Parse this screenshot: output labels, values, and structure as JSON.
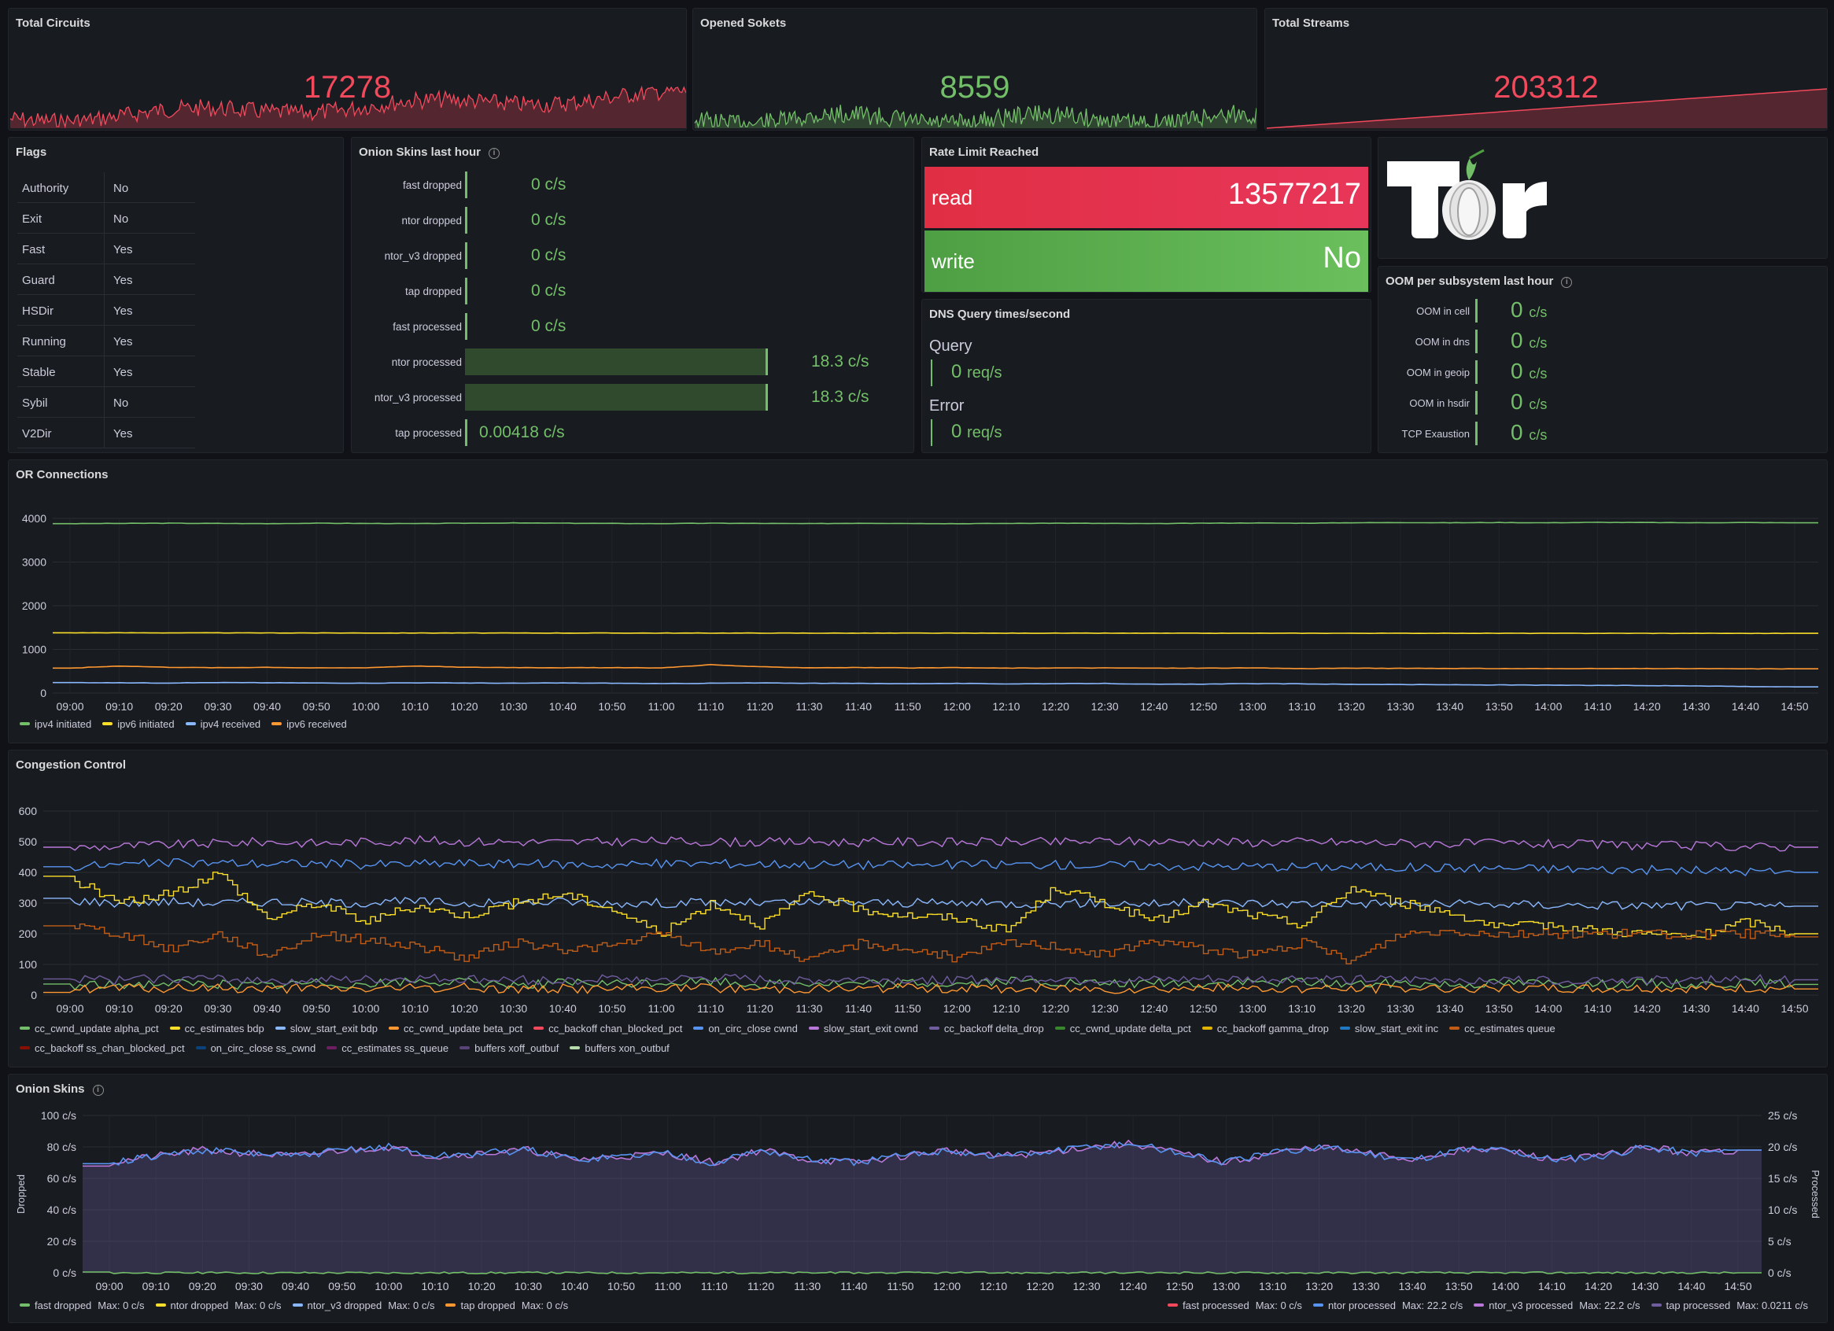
{
  "stats": {
    "total_circuits": {
      "title": "Total Circuits",
      "value": "17278",
      "color": "#f2495c"
    },
    "opened_sockets": {
      "title": "Opened Sokets",
      "value": "8559",
      "color": "#73bf69"
    },
    "total_streams": {
      "title": "Total Streams",
      "value": "203312",
      "color": "#f2495c"
    }
  },
  "flags": {
    "title": "Flags",
    "rows": [
      {
        "name": "Authority",
        "value": "No"
      },
      {
        "name": "Exit",
        "value": "No"
      },
      {
        "name": "Fast",
        "value": "Yes"
      },
      {
        "name": "Guard",
        "value": "Yes"
      },
      {
        "name": "HSDir",
        "value": "Yes"
      },
      {
        "name": "Running",
        "value": "Yes"
      },
      {
        "name": "Stable",
        "value": "Yes"
      },
      {
        "name": "Sybil",
        "value": "No"
      },
      {
        "name": "V2Dir",
        "value": "Yes"
      }
    ]
  },
  "onion_skins_hour": {
    "title": "Onion Skins last hour",
    "rows": [
      {
        "label": "fast dropped",
        "value": "0 c/s",
        "fill": 0
      },
      {
        "label": "ntor dropped",
        "value": "0 c/s",
        "fill": 0
      },
      {
        "label": "ntor_v3 dropped",
        "value": "0 c/s",
        "fill": 0
      },
      {
        "label": "tap dropped",
        "value": "0 c/s",
        "fill": 0
      },
      {
        "label": "fast processed",
        "value": "0 c/s",
        "fill": 0
      },
      {
        "label": "ntor processed",
        "value": "18.3 c/s",
        "fill": 0.82
      },
      {
        "label": "ntor_v3 processed",
        "value": "18.3 c/s",
        "fill": 0.82
      },
      {
        "label": "tap processed",
        "value": "0.00418 c/s",
        "fill": 0
      }
    ]
  },
  "rate_limit": {
    "title": "Rate Limit Reached",
    "read": {
      "label": "read",
      "value": "13577217",
      "color": "#e02f44"
    },
    "write": {
      "label": "write",
      "value": "No",
      "color": "#56a64b"
    }
  },
  "logo": {
    "text": "Tor"
  },
  "dns": {
    "title": "DNS Query times/second",
    "query": {
      "label": "Query",
      "value": "0",
      "unit": "req/s"
    },
    "error": {
      "label": "Error",
      "value": "0",
      "unit": "req/s"
    }
  },
  "oom": {
    "title": "OOM per subsystem last hour",
    "rows": [
      {
        "label": "OOM in cell",
        "value": "0",
        "unit": "c/s"
      },
      {
        "label": "OOM in dns",
        "value": "0",
        "unit": "c/s"
      },
      {
        "label": "OOM in geoip",
        "value": "0",
        "unit": "c/s"
      },
      {
        "label": "OOM in hsdir",
        "value": "0",
        "unit": "c/s"
      },
      {
        "label": "TCP Exaustion",
        "value": "0",
        "unit": "c/s"
      }
    ]
  },
  "time_ticks": [
    "09:00",
    "09:10",
    "09:20",
    "09:30",
    "09:40",
    "09:50",
    "10:00",
    "10:10",
    "10:20",
    "10:30",
    "10:40",
    "10:50",
    "11:00",
    "11:10",
    "11:20",
    "11:30",
    "11:40",
    "11:50",
    "12:00",
    "12:10",
    "12:20",
    "12:30",
    "12:40",
    "12:50",
    "13:00",
    "13:10",
    "13:20",
    "13:30",
    "13:40",
    "13:50",
    "14:00",
    "14:10",
    "14:20",
    "14:30",
    "14:40",
    "14:50"
  ],
  "or_connections": {
    "title": "OR Connections",
    "legend": [
      {
        "name": "ipv4 initiated",
        "color": "#73bf69"
      },
      {
        "name": "ipv6 initiated",
        "color": "#fade2a"
      },
      {
        "name": "ipv4 received",
        "color": "#8ab8ff"
      },
      {
        "name": "ipv6 received",
        "color": "#ff9830"
      }
    ]
  },
  "congestion": {
    "title": "Congestion Control",
    "legend_row1": [
      {
        "name": "cc_cwnd_update alpha_pct",
        "color": "#73bf69"
      },
      {
        "name": "cc_estimates bdp",
        "color": "#fade2a"
      },
      {
        "name": "slow_start_exit bdp",
        "color": "#8ab8ff"
      },
      {
        "name": "cc_cwnd_update beta_pct",
        "color": "#ff9830"
      },
      {
        "name": "cc_backoff chan_blocked_pct",
        "color": "#f2495c"
      },
      {
        "name": "on_circ_close cwnd",
        "color": "#5794f2"
      },
      {
        "name": "slow_start_exit cwnd",
        "color": "#b877d9"
      },
      {
        "name": "cc_backoff delta_drop",
        "color": "#705da0"
      },
      {
        "name": "cc_cwnd_update delta_pct",
        "color": "#37872d"
      },
      {
        "name": "cc_backoff gamma_drop",
        "color": "#e0b400"
      },
      {
        "name": "slow_start_exit inc",
        "color": "#1f78c1"
      },
      {
        "name": "cc_estimates queue",
        "color": "#c15c17"
      }
    ],
    "legend_row2": [
      {
        "name": "cc_backoff ss_chan_blocked_pct",
        "color": "#890f02"
      },
      {
        "name": "on_circ_close ss_cwnd",
        "color": "#0a437c"
      },
      {
        "name": "cc_estimates ss_queue",
        "color": "#6d1f62"
      },
      {
        "name": "buffers xoff_outbuf",
        "color": "#584477"
      },
      {
        "name": "buffers xon_outbuf",
        "color": "#b7dbab"
      }
    ]
  },
  "onion_skins": {
    "title": "Onion Skins",
    "y_left_label": "Dropped",
    "y_right_label": "Processed",
    "legend_left": [
      {
        "name": "fast dropped",
        "max": "Max: 0 c/s",
        "color": "#73bf69"
      },
      {
        "name": "ntor dropped",
        "max": "Max: 0 c/s",
        "color": "#fade2a"
      },
      {
        "name": "ntor_v3 dropped",
        "max": "Max: 0 c/s",
        "color": "#8ab8ff"
      },
      {
        "name": "tap dropped",
        "max": "Max: 0 c/s",
        "color": "#ff9830"
      }
    ],
    "legend_right": [
      {
        "name": "fast processed",
        "max": "Max: 0 c/s",
        "color": "#f2495c"
      },
      {
        "name": "ntor processed",
        "max": "Max: 22.2 c/s",
        "color": "#5794f2"
      },
      {
        "name": "ntor_v3 processed",
        "max": "Max: 22.2 c/s",
        "color": "#b877d9"
      },
      {
        "name": "tap processed",
        "max": "Max: 0.0211 c/s",
        "color": "#705da0"
      }
    ]
  },
  "chart_data": [
    {
      "type": "line",
      "title": "OR Connections",
      "x": [
        "09:00",
        "09:10",
        "09:20",
        "09:30",
        "09:40",
        "09:50",
        "10:00",
        "10:10",
        "10:20",
        "10:30",
        "10:40",
        "10:50",
        "11:00",
        "11:10",
        "11:20",
        "11:30",
        "11:40",
        "11:50",
        "12:00",
        "12:10",
        "12:20",
        "12:30",
        "12:40",
        "12:50",
        "13:00",
        "13:10",
        "13:20",
        "13:30",
        "13:40",
        "13:50",
        "14:00",
        "14:10",
        "14:20",
        "14:30",
        "14:40",
        "14:50"
      ],
      "ylim": [
        0,
        4000
      ],
      "yticks": [
        "0",
        "1000",
        "2000",
        "3000",
        "4000"
      ],
      "series": [
        {
          "name": "ipv4 initiated",
          "values": [
            3880,
            3885,
            3890,
            3885,
            3880,
            3890,
            3885,
            3880,
            3890,
            3895,
            3890,
            3885,
            3880,
            3890,
            3885,
            3880,
            3890,
            3885,
            3880,
            3885,
            3890,
            3885,
            3880,
            3890,
            3895,
            3890,
            3900,
            3905,
            3900,
            3905,
            3900,
            3910,
            3905,
            3900,
            3905,
            3900
          ]
        },
        {
          "name": "ipv6 initiated",
          "values": [
            1380,
            1380,
            1378,
            1378,
            1376,
            1376,
            1375,
            1375,
            1375,
            1374,
            1374,
            1374,
            1373,
            1373,
            1373,
            1372,
            1372,
            1372,
            1372,
            1371,
            1371,
            1371,
            1370,
            1370,
            1370,
            1370,
            1369,
            1369,
            1369,
            1369,
            1368,
            1368,
            1368,
            1368,
            1367,
            1367
          ]
        },
        {
          "name": "ipv4 received",
          "values": [
            240,
            235,
            230,
            240,
            235,
            230,
            225,
            235,
            230,
            225,
            230,
            225,
            215,
            225,
            230,
            225,
            220,
            215,
            220,
            210,
            215,
            220,
            200,
            205,
            215,
            210,
            200,
            195,
            190,
            185,
            180,
            175,
            170,
            165,
            150,
            140
          ]
        },
        {
          "name": "ipv6 received",
          "values": [
            570,
            620,
            590,
            580,
            590,
            575,
            580,
            620,
            590,
            585,
            580,
            580,
            575,
            650,
            600,
            580,
            585,
            575,
            580,
            570,
            575,
            575,
            570,
            570,
            575,
            560,
            570,
            565,
            565,
            560,
            560,
            560,
            560,
            560,
            555,
            555
          ]
        }
      ]
    },
    {
      "type": "line",
      "title": "Congestion Control",
      "x": [
        "09:00",
        "09:10",
        "09:20",
        "09:30",
        "09:40",
        "09:50",
        "10:00",
        "10:10",
        "10:20",
        "10:30",
        "10:40",
        "10:50",
        "11:00",
        "11:10",
        "11:20",
        "11:30",
        "11:40",
        "11:50",
        "12:00",
        "12:10",
        "12:20",
        "12:30",
        "12:40",
        "12:50",
        "13:00",
        "13:10",
        "13:20",
        "13:30",
        "13:40",
        "13:50",
        "14:00",
        "14:10",
        "14:20",
        "14:30",
        "14:40",
        "14:50"
      ],
      "ylim": [
        0,
        600
      ],
      "yticks": [
        "0",
        "100",
        "200",
        "300",
        "400",
        "500",
        "600"
      ],
      "series": [
        {
          "name": "slow_start_exit cwnd",
          "values": [
            480,
            485,
            490,
            495,
            500,
            495,
            500,
            505,
            500,
            500,
            498,
            500,
            502,
            500,
            498,
            500,
            498,
            500,
            498,
            500,
            498,
            502,
            500,
            500,
            498,
            500,
            498,
            496,
            494,
            494,
            492,
            490,
            488,
            486,
            484,
            482
          ]
        },
        {
          "name": "on_circ_close cwnd",
          "values": [
            420,
            425,
            430,
            432,
            428,
            430,
            425,
            428,
            430,
            428,
            426,
            425,
            428,
            430,
            428,
            426,
            425,
            424,
            425,
            426,
            425,
            423,
            422,
            420,
            420,
            418,
            418,
            416,
            415,
            414,
            412,
            410,
            408,
            406,
            404,
            400
          ]
        },
        {
          "name": "slow_start_exit bdp",
          "values": [
            310,
            300,
            305,
            300,
            305,
            300,
            302,
            305,
            300,
            300,
            305,
            300,
            300,
            302,
            300,
            300,
            302,
            300,
            300,
            298,
            300,
            300,
            298,
            300,
            300,
            298,
            300,
            298,
            296,
            296,
            294,
            294,
            292,
            292,
            290,
            290
          ]
        },
        {
          "name": "cc_estimates bdp",
          "values": [
            380,
            300,
            330,
            400,
            250,
            300,
            240,
            290,
            260,
            300,
            330,
            280,
            200,
            300,
            230,
            330,
            280,
            260,
            250,
            210,
            350,
            300,
            240,
            300,
            260,
            230,
            350,
            300,
            270,
            220,
            230,
            210,
            200,
            190,
            240,
            200
          ]
        },
        {
          "name": "cc_estimates queue",
          "values": [
            230,
            200,
            150,
            200,
            130,
            200,
            180,
            160,
            120,
            170,
            150,
            160,
            200,
            140,
            170,
            110,
            170,
            150,
            120,
            170,
            160,
            130,
            180,
            150,
            130,
            170,
            110,
            200,
            210,
            200,
            200,
            200,
            200,
            195,
            200,
            190
          ]
        },
        {
          "name": "cc_cwnd_update alpha_pct",
          "values": [
            30,
            35,
            40,
            35,
            30,
            40,
            35,
            45,
            40,
            35,
            40,
            35,
            40,
            45,
            35,
            40,
            35,
            40,
            35,
            45,
            40,
            35,
            40,
            35,
            40,
            45,
            35,
            40,
            35,
            40,
            40,
            35,
            40,
            35,
            40,
            35
          ]
        },
        {
          "name": "cc_cwnd_update beta_pct",
          "values": [
            20,
            22,
            20,
            24,
            20,
            22,
            20,
            22,
            24,
            20,
            22,
            20,
            24,
            22,
            20,
            22,
            20,
            24,
            22,
            20,
            22,
            20,
            22,
            24,
            20,
            22,
            20,
            22,
            24,
            20,
            22,
            20,
            22,
            20,
            22,
            20
          ]
        },
        {
          "name": "cc_backoff delta_drop",
          "values": [
            50,
            48,
            55,
            52,
            50,
            48,
            50,
            55,
            52,
            50,
            48,
            52,
            50,
            55,
            50,
            48,
            52,
            50,
            48,
            52,
            55,
            50,
            48,
            52,
            50,
            55,
            50,
            48,
            52,
            50,
            48,
            52,
            50,
            48,
            52,
            50
          ]
        }
      ]
    },
    {
      "type": "area",
      "title": "Onion Skins",
      "x": [
        "09:00",
        "09:10",
        "09:20",
        "09:30",
        "09:40",
        "09:50",
        "10:00",
        "10:10",
        "10:20",
        "10:30",
        "10:40",
        "10:50",
        "11:00",
        "11:10",
        "11:20",
        "11:30",
        "11:40",
        "11:50",
        "12:00",
        "12:10",
        "12:20",
        "12:30",
        "12:40",
        "12:50",
        "13:00",
        "13:10",
        "13:20",
        "13:30",
        "13:40",
        "13:50",
        "14:00",
        "14:10",
        "14:20",
        "14:30",
        "14:40",
        "14:50"
      ],
      "ylabel": "Dropped",
      "ylim": [
        0,
        100
      ],
      "yticks": [
        "0 c/s",
        "20 c/s",
        "40 c/s",
        "60 c/s",
        "80 c/s",
        "100 c/s"
      ],
      "y2label": "Processed",
      "y2lim": [
        0,
        25
      ],
      "y2ticks": [
        "0 c/s",
        "5 c/s",
        "10 c/s",
        "15 c/s",
        "20 c/s",
        "25 c/s"
      ],
      "series": [
        {
          "name": "ntor_v3 processed",
          "axis": "right",
          "values": [
            17.5,
            18.5,
            19.5,
            19,
            18.5,
            19.5,
            20,
            18.5,
            19,
            19.5,
            18,
            18.5,
            19,
            17.5,
            19.5,
            18,
            17.5,
            18.5,
            19.5,
            18.5,
            19,
            20,
            20.5,
            19,
            17.5,
            19,
            20,
            19,
            18,
            19.5,
            19.5,
            18,
            18.5,
            20,
            19,
            19.5
          ]
        },
        {
          "name": "ntor processed",
          "axis": "right",
          "values": [
            17.5,
            18.5,
            19.5,
            19,
            18.5,
            19.5,
            20,
            18.5,
            19,
            19.5,
            18,
            18.5,
            19,
            17.5,
            19.5,
            18,
            17.5,
            18.5,
            19.5,
            18.5,
            19,
            20,
            20.5,
            19,
            17.5,
            19,
            20,
            19,
            18,
            19.5,
            19.5,
            18,
            18.5,
            20,
            19,
            19.5
          ]
        },
        {
          "name": "fast dropped",
          "axis": "left",
          "values": [
            0,
            0,
            0,
            0,
            0,
            0,
            0,
            0,
            0,
            0,
            0,
            0,
            0,
            0,
            0,
            0,
            0,
            0,
            0,
            0,
            0,
            0,
            0,
            0,
            0,
            0,
            0,
            0,
            0,
            0,
            0,
            0,
            0,
            0,
            0,
            0
          ]
        }
      ]
    }
  ]
}
